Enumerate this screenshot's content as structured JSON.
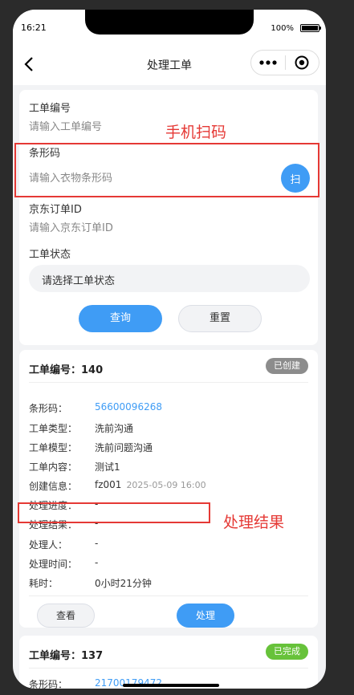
{
  "status_bar": {
    "time": "16:21",
    "battery": "100%"
  },
  "nav": {
    "title": "处理工单"
  },
  "filter": {
    "order_no_label": "工单编号",
    "order_no_placeholder": "请输入工单编号",
    "barcode_label": "条形码",
    "barcode_placeholder": "请输入衣物条形码",
    "scan_label": "扫",
    "jd_label": "京东订单ID",
    "jd_placeholder": "请输入京东订单ID",
    "status_label": "工单状态",
    "status_placeholder": "请选择工单状态",
    "query_label": "查询",
    "reset_label": "重置"
  },
  "annotations": {
    "scan_note": "手机扫码",
    "result_note": "处理结果"
  },
  "order1": {
    "title": "工单编号：140",
    "badge": "已创建",
    "badge_color": "#8c8c8c",
    "rows": [
      {
        "key": "条形码：",
        "value": "56600096268"
      },
      {
        "key": "工单类型：",
        "value": "洗前沟通"
      },
      {
        "key": "工单模型：",
        "value": "洗前问题沟通"
      },
      {
        "key": "工单内容：",
        "value": "测试1"
      },
      {
        "key": "创建信息：",
        "value": "fz001",
        "time": "2025-05-09 16:00"
      },
      {
        "key": "处理进度：",
        "value": "-"
      },
      {
        "key": "处理结果：",
        "value": "-"
      },
      {
        "key": "处理人：",
        "value": "-"
      },
      {
        "key": "处理时间：",
        "value": "-"
      },
      {
        "key": "耗时：",
        "value": "0小时21分钟"
      }
    ],
    "view_label": "查看",
    "process_label": "处理"
  },
  "order2": {
    "title": "工单编号：137",
    "badge": "已完成",
    "badge_color": "#67c23a",
    "barcode_key": "条形码：",
    "barcode_value": "21700179472"
  },
  "accent_color": "#3f9cf5"
}
